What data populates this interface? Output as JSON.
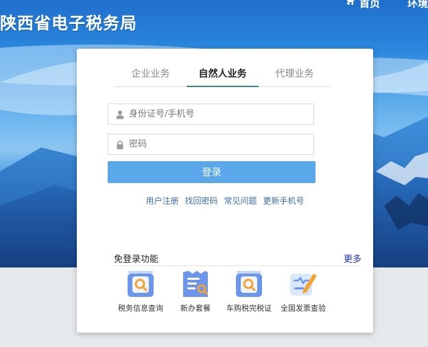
{
  "header": {
    "site_title": "陕西省电子税务局",
    "nav": [
      {
        "label": "首页",
        "icon": "home-icon"
      },
      {
        "label": "环境",
        "icon": "wrench-icon"
      }
    ]
  },
  "login": {
    "tabs": [
      {
        "label": "企业业务",
        "active": false
      },
      {
        "label": "自然人业务",
        "active": true
      },
      {
        "label": "代理业务",
        "active": false
      }
    ],
    "username": {
      "placeholder": "身份证号/手机号",
      "value": "",
      "icon": "user-icon"
    },
    "password": {
      "placeholder": "密码",
      "value": "",
      "icon": "lock-icon"
    },
    "submit_label": "登录",
    "links": [
      "用户注册",
      "找回密码",
      "常见问题",
      "更新手机号"
    ]
  },
  "free_login": {
    "title": "免登录功能",
    "more_label": "更多",
    "services": [
      {
        "label": "税务信息查询",
        "icon": "tax-info-search-icon"
      },
      {
        "label": "新办套餐",
        "icon": "new-package-icon"
      },
      {
        "label": "车购税完税证",
        "icon": "vehicle-tax-certificate-icon"
      },
      {
        "label": "全国发票查验",
        "icon": "invoice-verify-icon"
      }
    ]
  },
  "colors": {
    "brand_blue": "#2b86dc",
    "login_button": "#5aa8ea",
    "tab_underline": "#3c8a7e",
    "link": "#3a6ea8",
    "more_link": "#1a2fb0"
  }
}
